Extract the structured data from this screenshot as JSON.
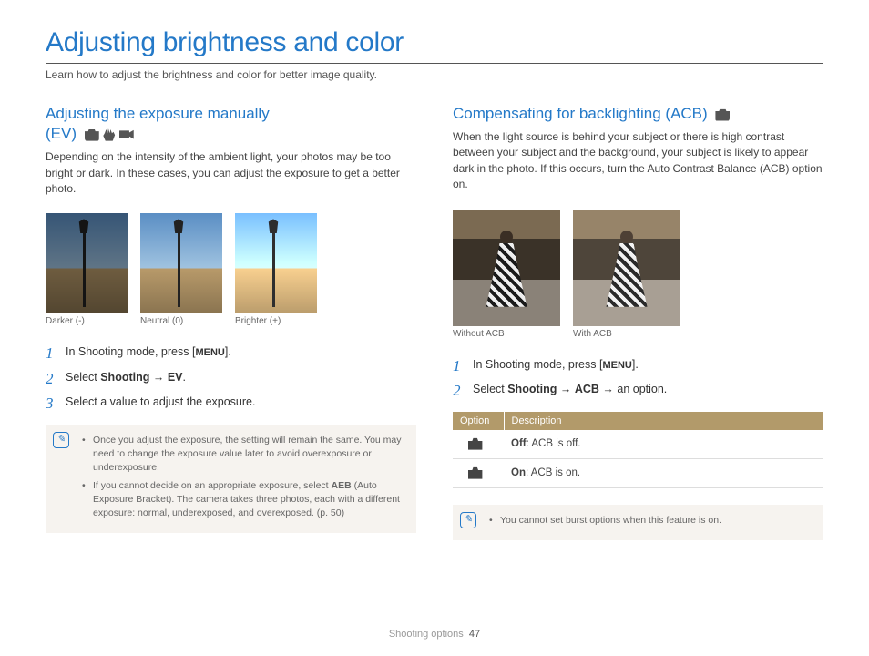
{
  "page": {
    "title": "Adjusting brightness and color",
    "intro": "Learn how to adjust the brightness and color for better image quality."
  },
  "left": {
    "heading_line1": "Adjusting the exposure manually",
    "heading_line2": "(EV)",
    "body": "Depending on the intensity of the ambient light, your photos may be too bright or dark. In these cases, you can adjust the exposure to get a better photo.",
    "captions": {
      "a": "Darker (-)",
      "b": "Neutral (0)",
      "c": "Brighter (+)"
    },
    "steps": {
      "s1a": "In Shooting mode, press [",
      "s1b": "MENU",
      "s1c": "].",
      "s2a": "Select ",
      "s2b": "Shooting",
      "s2c": " → ",
      "s2d": "EV",
      "s2e": ".",
      "s3": "Select a value to adjust the exposure."
    },
    "note": {
      "n1": "Once you adjust the exposure, the setting will remain the same. You may need to change the exposure value later to avoid overexposure or underexposure.",
      "n2a": "If you cannot decide on an appropriate exposure, select ",
      "n2b": "AEB",
      "n2c": " (Auto Exposure Bracket). The camera takes three photos, each with a different exposure: normal, underexposed, and overexposed. (p. 50)"
    }
  },
  "right": {
    "heading": "Compensating for backlighting (ACB)",
    "body": "When the light source is behind your subject or there is high contrast between your subject and the background, your subject is likely to appear dark in the photo. If this occurs, turn the Auto Contrast Balance (ACB) option on.",
    "captions": {
      "a": "Without ACB",
      "b": "With ACB"
    },
    "steps": {
      "s1a": "In Shooting mode, press [",
      "s1b": "MENU",
      "s1c": "].",
      "s2a": "Select ",
      "s2b": "Shooting",
      "s2c": " → ",
      "s2d": "ACB",
      "s2e": " → an option."
    },
    "table": {
      "h1": "Option",
      "h2": "Description",
      "r1b": "Off",
      "r1c": ": ACB is off.",
      "r2b": "On",
      "r2c": ": ACB is on."
    },
    "note": "You cannot set burst options when this feature is on."
  },
  "footer": {
    "section": "Shooting options",
    "page": "47"
  }
}
